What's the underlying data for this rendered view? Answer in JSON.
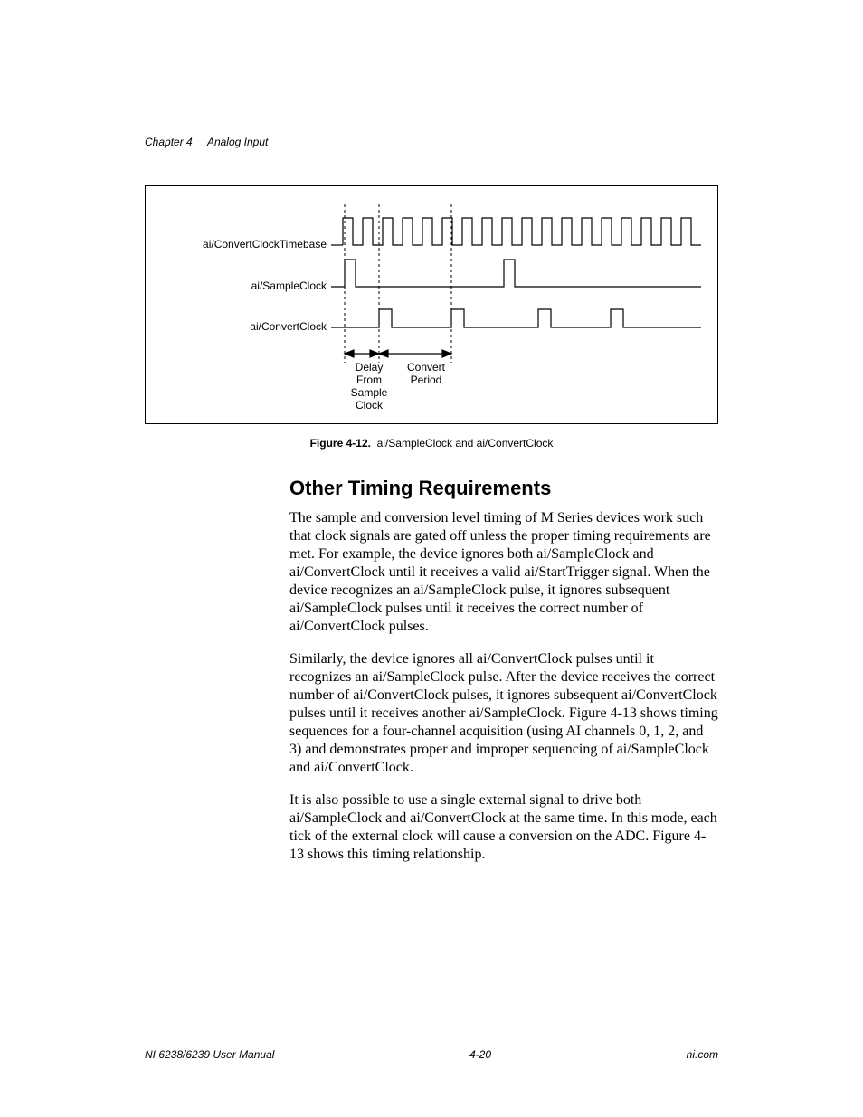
{
  "header": {
    "chapter_label": "Chapter 4",
    "chapter_title": "Analog Input"
  },
  "figure": {
    "signal_labels": {
      "row1": "ai/ConvertClockTimebase",
      "row2": "ai/SampleClock",
      "row3": "ai/ConvertClock"
    },
    "annotations": {
      "delay_line1": "Delay",
      "delay_line2": "From",
      "delay_line3": "Sample",
      "delay_line4": "Clock",
      "period_line1": "Convert",
      "period_line2": "Period"
    },
    "caption_number": "Figure 4-12.",
    "caption_text": "ai/SampleClock and ai/ConvertClock"
  },
  "section": {
    "heading": "Other Timing Requirements",
    "p1": "The sample and conversion level timing of M Series devices work such that clock signals are gated off unless the proper timing requirements are met. For example, the device ignores both ai/SampleClock and ai/ConvertClock until it receives a valid ai/StartTrigger signal. When the device recognizes an ai/SampleClock pulse, it ignores subsequent ai/SampleClock pulses until it receives the correct number of ai/ConvertClock pulses.",
    "p2": "Similarly, the device ignores all ai/ConvertClock pulses until it recognizes an ai/SampleClock pulse. After the device receives the correct number of ai/ConvertClock pulses, it ignores subsequent ai/ConvertClock pulses until it receives another ai/SampleClock. Figure 4-13 shows timing sequences for a four-channel acquisition (using AI channels 0, 1, 2, and 3) and demonstrates proper and improper sequencing of ai/SampleClock and ai/ConvertClock.",
    "p3": "It is also possible to use a single external signal to drive both ai/SampleClock and ai/ConvertClock at the same time. In this mode, each tick of the external clock will cause a conversion on the ADC. Figure 4-13 shows this timing relationship."
  },
  "footer": {
    "left": "NI 6238/6239 User Manual",
    "center": "4-20",
    "right": "ni.com"
  },
  "chart_data": {
    "type": "table",
    "description": "Timing diagram showing three digital signals and annotated intervals.",
    "signals": [
      {
        "name": "ai/ConvertClockTimebase",
        "pattern": "continuous square wave (high-frequency timebase)"
      },
      {
        "name": "ai/SampleClock",
        "pattern": "two narrow pulses; first pulse precedes the convert-clock burst, second pulse in the middle"
      },
      {
        "name": "ai/ConvertClock",
        "pattern": "series of narrow pulses spaced by the Convert Period, starting after the first ai/SampleClock pulse"
      }
    ],
    "intervals": [
      {
        "name": "Delay From Sample Clock",
        "from": "rising edge of ai/SampleClock",
        "to": "first ai/ConvertClock pulse"
      },
      {
        "name": "Convert Period",
        "from": "one ai/ConvertClock pulse",
        "to": "next ai/ConvertClock pulse"
      }
    ]
  }
}
